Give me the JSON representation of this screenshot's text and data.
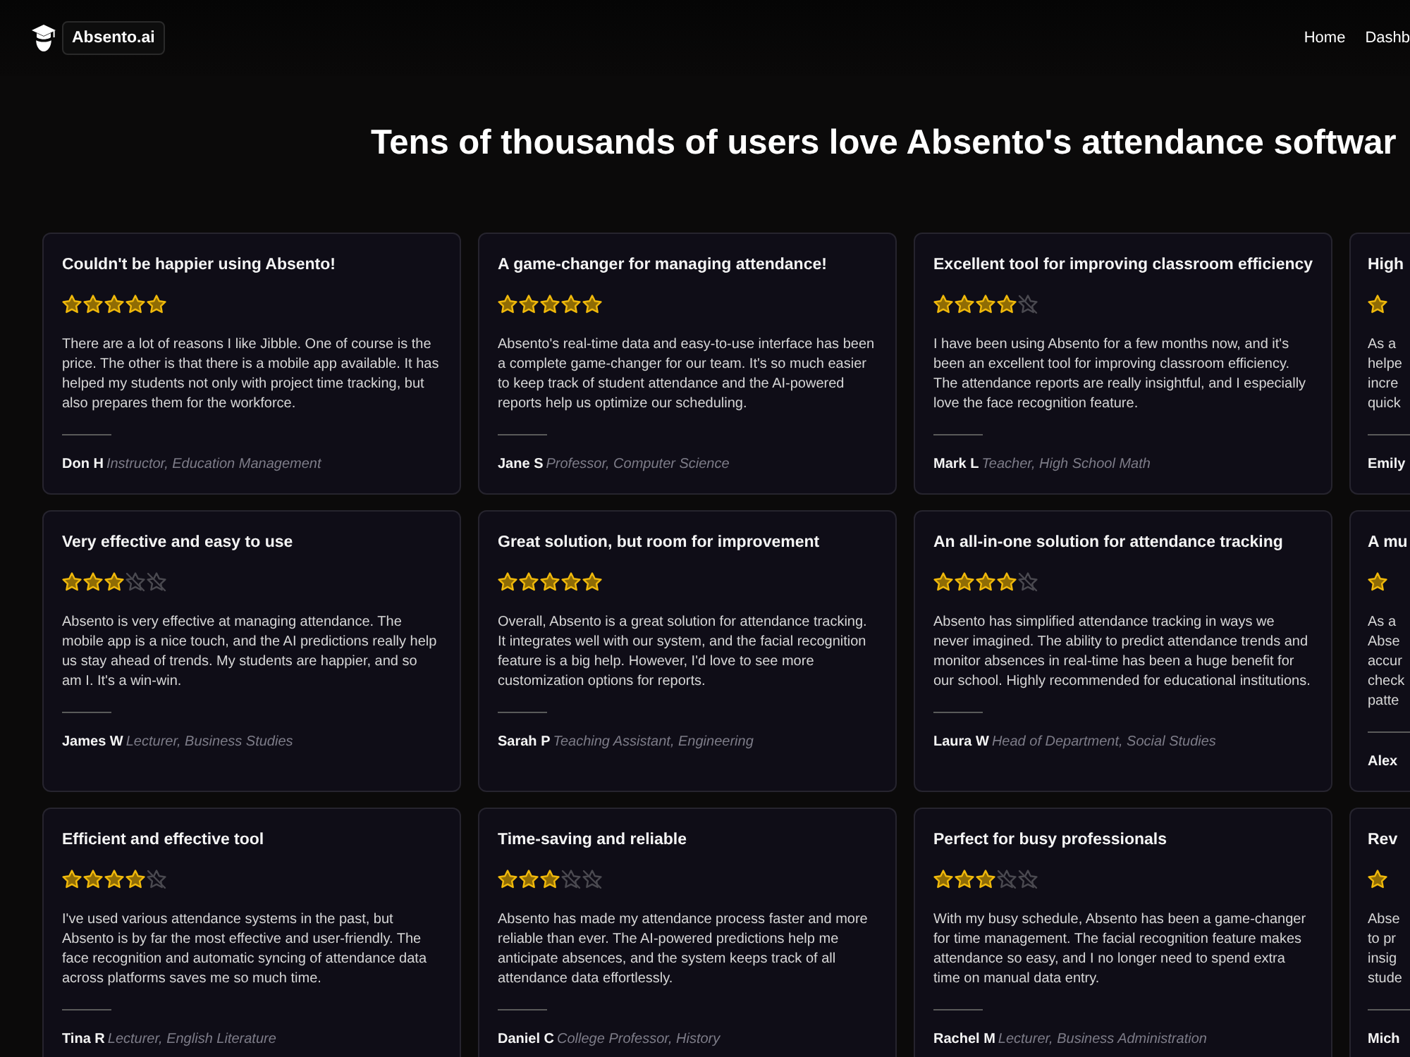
{
  "navbar": {
    "brand": "Absento.ai",
    "links": [
      "Home",
      "Dashb"
    ]
  },
  "heading": "Tens of thousands of users love Absento's attendance softwar",
  "reviews": [
    {
      "kind": "full",
      "title": "Couldn't be happier using Absento!",
      "stars": 5,
      "body": "There are a lot of reasons I like Jibble. One of course is the price. The other is that there is a mobile app available. It has helped my students not only with project time tracking, but also prepares them for the workforce.",
      "name": "Don H",
      "role": "Instructor, Education Management"
    },
    {
      "kind": "full",
      "title": "A game-changer for managing attendance!",
      "stars": 5,
      "body": "Absento's real-time data and easy-to-use interface has been a complete game-changer for our team. It's so much easier to keep track of student attendance and the AI-powered reports help us optimize our scheduling.",
      "name": "Jane S",
      "role": "Professor, Computer Science"
    },
    {
      "kind": "full",
      "title": "Excellent tool for improving classroom efficiency",
      "stars": 4,
      "body": "I have been using Absento for a few months now, and it's been an excellent tool for improving classroom efficiency. The attendance reports are really insightful, and I especially love the face recognition feature.",
      "name": "Mark L",
      "role": "Teacher, High School Math"
    },
    {
      "kind": "cut",
      "title": "High",
      "body": "As a\nhelpe\nincre\nquick",
      "name": "Emily"
    },
    {
      "kind": "full",
      "title": "Very effective and easy to use",
      "stars": 3,
      "body": "Absento is very effective at managing attendance. The mobile app is a nice touch, and the AI predictions really help us stay ahead of trends. My students are happier, and so am I. It's a win-win.",
      "name": "James W",
      "role": "Lecturer, Business Studies"
    },
    {
      "kind": "full",
      "title": "Great solution, but room for improvement",
      "stars": 5,
      "body": "Overall, Absento is a great solution for attendance tracking. It integrates well with our system, and the facial recognition feature is a big help. However, I'd love to see more customization options for reports.",
      "name": "Sarah P",
      "role": "Teaching Assistant, Engineering"
    },
    {
      "kind": "full",
      "title": "An all-in-one solution for attendance tracking",
      "stars": 4,
      "body": "Absento has simplified attendance tracking in ways we never imagined. The ability to predict attendance trends and monitor absences in real-time has been a huge benefit for our school. Highly recommended for educational institutions.",
      "name": "Laura W",
      "role": "Head of Department, Social Studies"
    },
    {
      "kind": "cut",
      "title": "A mu",
      "body": "As a\nAbse\naccur\ncheck\npatte",
      "name": "Alex"
    },
    {
      "kind": "full",
      "title": "Efficient and effective tool",
      "stars": 4,
      "body": "I've used various attendance systems in the past, but Absento is by far the most effective and user-friendly. The face recognition and automatic syncing of attendance data across platforms saves me so much time.",
      "name": "Tina R",
      "role": "Lecturer, English Literature"
    },
    {
      "kind": "full",
      "title": "Time-saving and reliable",
      "stars": 3,
      "body": "Absento has made my attendance process faster and more reliable than ever. The AI-powered predictions help me anticipate absences, and the system keeps track of all attendance data effortlessly.",
      "name": "Daniel C",
      "role": "College Professor, History"
    },
    {
      "kind": "full",
      "title": "Perfect for busy professionals",
      "stars": 3,
      "body": "With my busy schedule, Absento has been a game-changer for time management. The facial recognition feature makes attendance so easy, and I no longer need to spend extra time on manual data entry.",
      "name": "Rachel M",
      "role": "Lecturer, Business Administration"
    },
    {
      "kind": "cut",
      "title": "Rev",
      "body": "Abse\nto pr\ninsig\nstude",
      "name": "Mich"
    }
  ]
}
